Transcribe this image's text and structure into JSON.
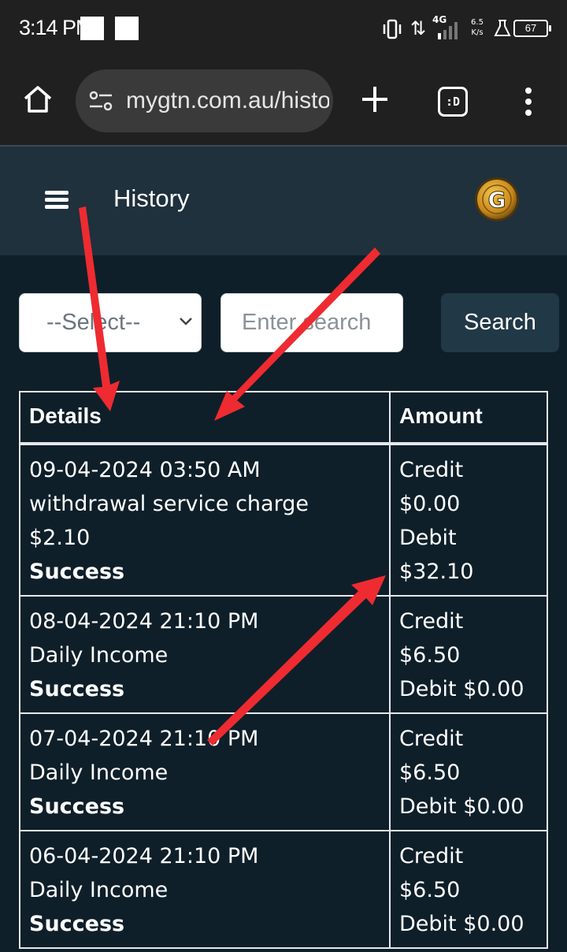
{
  "status_bar": {
    "time": "3:14 PM",
    "network": "4G",
    "speed_value": "6.5",
    "speed_unit": "K/s",
    "battery": "67"
  },
  "browser": {
    "url": "mygtn.com.au/history",
    "tabs_label": ":D"
  },
  "app": {
    "title": "History",
    "logo_letter": "G"
  },
  "filters": {
    "select_value": "--Select--",
    "search_placeholder": "Enter search",
    "search_button": "Search"
  },
  "table": {
    "headers": [
      "Details",
      "Amount"
    ],
    "rows": [
      {
        "datetime": "09-04-2024 03:50 AM",
        "description": "withdrawal service charge",
        "extra": "$2.10",
        "status": "Success",
        "amount_lines": [
          "Credit",
          "$0.00",
          "Debit",
          "$32.10"
        ]
      },
      {
        "datetime": "08-04-2024 21:10 PM",
        "description": "Daily Income",
        "status": "Success",
        "amount_lines": [
          "Credit",
          "$6.50",
          "Debit $0.00"
        ]
      },
      {
        "datetime": "07-04-2024 21:10 PM",
        "description": "Daily Income",
        "status": "Success",
        "amount_lines": [
          "Credit",
          "$6.50",
          "Debit $0.00"
        ]
      },
      {
        "datetime": "06-04-2024 21:10 PM",
        "description": "Daily Income",
        "status": "Success",
        "amount_lines": [
          "Credit",
          "$6.50",
          "Debit $0.00"
        ]
      }
    ]
  },
  "colors": {
    "page_bg": "#0f1f29",
    "header_bg": "#1e313d",
    "button_bg": "#213846",
    "annotation_arrow": "#ee2b31"
  }
}
